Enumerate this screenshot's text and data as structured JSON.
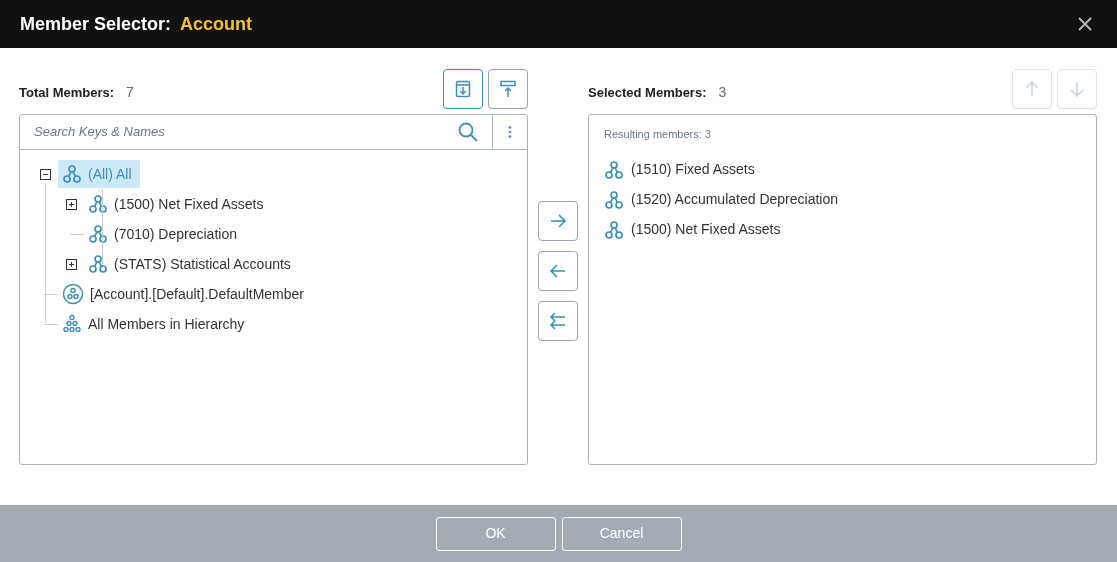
{
  "window": {
    "title": "Member Selector:",
    "subject": "Account"
  },
  "left": {
    "label": "Total Members:",
    "count": "7",
    "toolbar": [
      {
        "kind": "expand",
        "selected": true
      },
      {
        "kind": "collapse",
        "selected": false
      }
    ],
    "search": {
      "placeholder": "Search Keys & Names"
    },
    "tree": [
      {
        "label": "(All) All",
        "kind": "member",
        "selected": true,
        "expanded": true,
        "children": [
          {
            "label": "(1500) Net Fixed Assets",
            "kind": "member",
            "selected": false,
            "expanded": false
          },
          {
            "label": "(7010) Depreciation",
            "kind": "member",
            "selected": false
          },
          {
            "label": "(STATS) Statistical Accounts",
            "kind": "member",
            "selected": false,
            "expanded": false
          }
        ]
      },
      {
        "label": "[Account].[Default].DefaultMember",
        "kind": "default",
        "selected": false
      },
      {
        "label": "All Members in Hierarchy",
        "kind": "all",
        "selected": false
      }
    ]
  },
  "transfer": [
    {
      "kind": "add"
    },
    {
      "kind": "remove"
    },
    {
      "kind": "remove_all"
    }
  ],
  "right": {
    "label": "Selected Members:",
    "count": "3",
    "toolbar": [
      {
        "kind": "up",
        "disabled": true
      },
      {
        "kind": "down",
        "disabled": true
      }
    ],
    "summary": "Resulting members: 3",
    "items": [
      {
        "label": "(1510) Fixed Assets",
        "kind": "member"
      },
      {
        "label": "(1520) Accumulated Depreciation",
        "kind": "member"
      },
      {
        "label": "(1500) Net Fixed Assets",
        "kind": "member"
      }
    ]
  },
  "buttons": [
    "OK",
    "Cancel"
  ]
}
